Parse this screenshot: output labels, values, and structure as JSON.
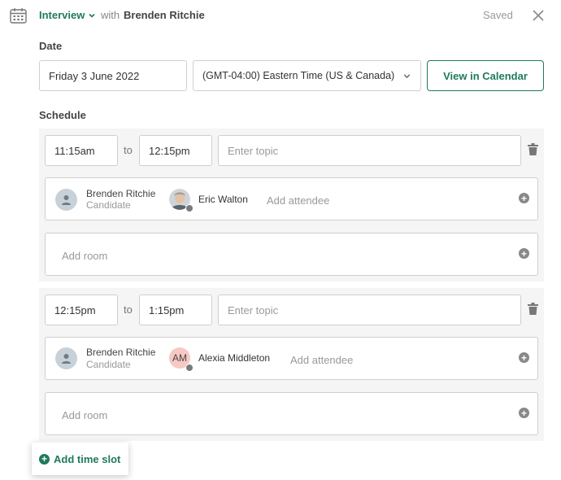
{
  "header": {
    "event_type": "Interview",
    "with_label": "with",
    "candidate_name": "Brenden Ritchie",
    "status": "Saved"
  },
  "date_section": {
    "label": "Date",
    "date_value": "Friday 3 June 2022",
    "timezone_value": "(GMT-04:00) Eastern Time (US & Canada)",
    "view_calendar_label": "View in Calendar"
  },
  "schedule": {
    "label": "Schedule",
    "to_label": "to",
    "topic_placeholder": "Enter topic",
    "add_attendee_placeholder": "Add attendee",
    "add_room_placeholder": "Add room",
    "slots": [
      {
        "start": "11:15am",
        "end": "12:15pm",
        "candidate": {
          "name": "Brenden Ritchie",
          "role": "Candidate"
        },
        "attendee": {
          "name": "Eric Walton",
          "avatar": "photo"
        }
      },
      {
        "start": "12:15pm",
        "end": "1:15pm",
        "candidate": {
          "name": "Brenden Ritchie",
          "role": "Candidate"
        },
        "attendee": {
          "name": "Alexia Middleton",
          "initials": "AM"
        }
      }
    ],
    "add_slot_label": "Add time slot"
  },
  "colors": {
    "accent": "#1f7a5c",
    "slot_background": "#f5f5f5",
    "initials_avatar": "#f6c9c4"
  },
  "icons": [
    "calendar-icon",
    "chevron-down-icon",
    "close-icon",
    "trash-icon",
    "person-icon",
    "plus-circle-icon"
  ]
}
